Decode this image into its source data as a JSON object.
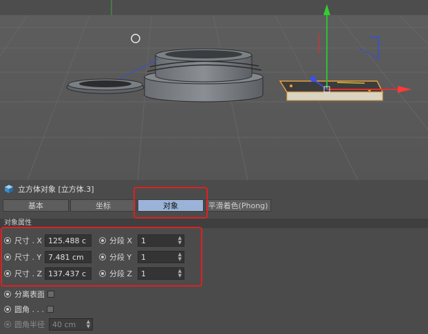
{
  "object_header": {
    "icon": "cube-icon",
    "title": "立方体对象 [立方体.3]"
  },
  "tabs": [
    {
      "label": "基本",
      "active": false
    },
    {
      "label": "坐标",
      "active": false
    },
    {
      "label": "对象",
      "active": true
    },
    {
      "label": "平滑着色(Phong)",
      "active": false
    }
  ],
  "section": {
    "title": "对象属性"
  },
  "size_props": [
    {
      "label": "尺寸 . X",
      "value": "125.488 c"
    },
    {
      "label": "尺寸 . Y",
      "value": "7.481 cm"
    },
    {
      "label": "尺寸 . Z",
      "value": "137.437 c"
    }
  ],
  "segment_props": [
    {
      "label": "分段 X",
      "value": "1"
    },
    {
      "label": "分段 Y",
      "value": "1"
    },
    {
      "label": "分段 Z",
      "value": "1"
    }
  ],
  "options": [
    {
      "label": "分离表面",
      "checked": false
    },
    {
      "label": "圆角 . . .",
      "checked": false
    }
  ],
  "fillet_radius": {
    "label": "圆角半径",
    "value": "40 cm",
    "enabled": false
  },
  "colors": {
    "active_tab": "#9bb3d8",
    "highlight": "#e02020",
    "axis_x": "#e03030",
    "axis_y": "#30c030",
    "axis_z": "#3050e0"
  }
}
